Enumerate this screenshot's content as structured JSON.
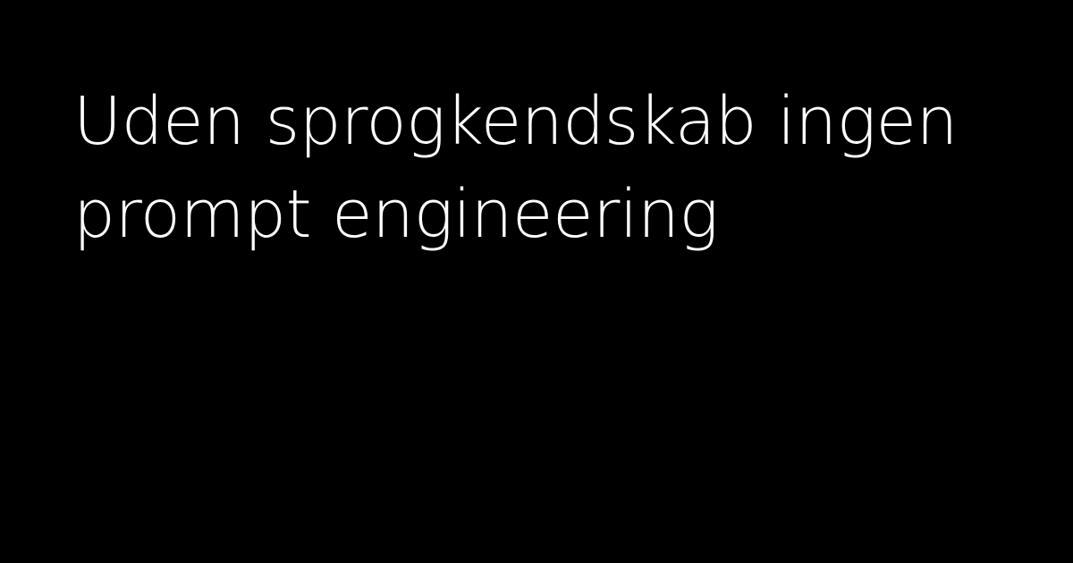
{
  "headline": {
    "line1": "Uden sprogkendskab ingen",
    "line2": "prompt engineering"
  },
  "colors": {
    "background": "#000000",
    "text": "#ffffff"
  }
}
